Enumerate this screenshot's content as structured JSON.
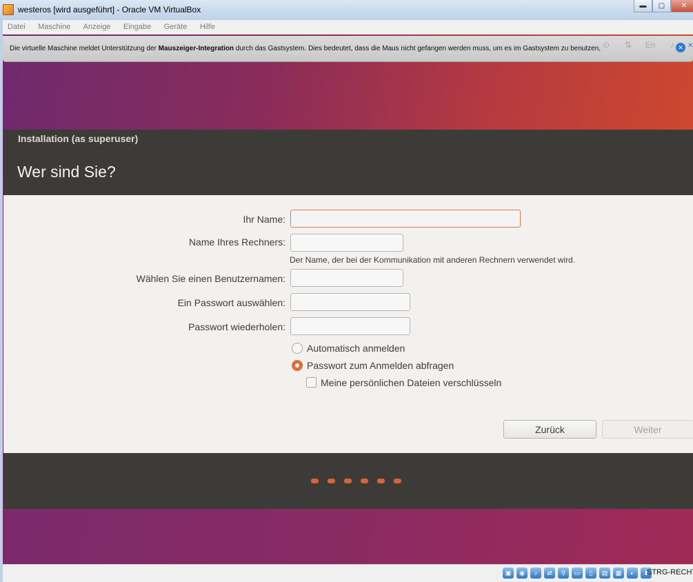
{
  "window": {
    "title": "westeros [wird ausgeführt] - Oracle VM VirtualBox"
  },
  "menu": [
    "Datei",
    "Maschine",
    "Anzeige",
    "Eingabe",
    "Geräte",
    "Hilfe"
  ],
  "notification": {
    "text_before": "Die virtuelle Maschine meldet Unterstützung der ",
    "text_bold": "Mauszeiger-Integration",
    "text_after": " durch das Gastsystem. Dies bedeutet, dass die Maus nicht gefangen werden muss, um es im Gastsystem zu benutzen,"
  },
  "installer": {
    "window_title": "Installation (as superuser)",
    "heading": "Wer sind Sie?",
    "fields": {
      "name_label": "Ihr Name:",
      "name_value": "",
      "computer_label": "Name Ihres Rechners:",
      "computer_value": "",
      "computer_hint": "Der Name, der bei der Kommunikation mit anderen Rechnern verwendet wird.",
      "username_label": "Wählen Sie einen Benutzernamen:",
      "username_value": "",
      "password_label": "Ein Passwort auswählen:",
      "password_value": "",
      "password_repeat_label": "Passwort wiederholen:",
      "password_repeat_value": ""
    },
    "options": {
      "auto_login": "Automatisch anmelden",
      "require_password": "Passwort zum Anmelden abfragen",
      "encrypt_home": "Meine persönlichen Dateien verschlüsseln",
      "selected": "require_password"
    },
    "buttons": {
      "back": "Zurück",
      "next": "Weiter"
    },
    "progress_dots": 6
  },
  "statusbar": {
    "host_key": "STRG-RECHTS"
  },
  "colors": {
    "accent": "#e26b3a",
    "header": "#3c3b37"
  }
}
